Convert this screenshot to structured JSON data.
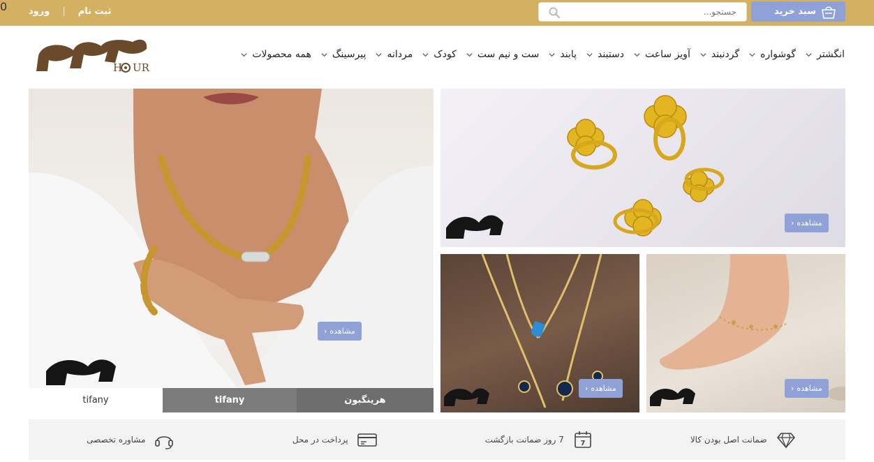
{
  "topbar": {
    "login": "ورود",
    "register": "ثبت نام",
    "divider": "|",
    "search_placeholder": "جستجو...",
    "cart_label": "سبد خرید",
    "cart_count": "0"
  },
  "nav": {
    "items": [
      "انگشتر",
      "گوشواره",
      "گردنبند",
      "آویز ساعت",
      "دستبند",
      "پابند",
      "ست و نیم ست",
      "کودک",
      "مردانه",
      "پیرسینگ",
      "همه محصولات"
    ]
  },
  "banners": {
    "view_label": "مشاهده",
    "view_arrow": "›"
  },
  "tabs": [
    "tifany",
    "tifany",
    "هرینگبون"
  ],
  "features": [
    "ضمانت اصل بودن کالا",
    "7 روز ضمانت بازگشت",
    "پرداخت در محل",
    "مشاوره تخصصی"
  ],
  "colors": {
    "gold": "#d4b062",
    "accent": "#8fa1d6",
    "badge": "#f0d80e"
  }
}
